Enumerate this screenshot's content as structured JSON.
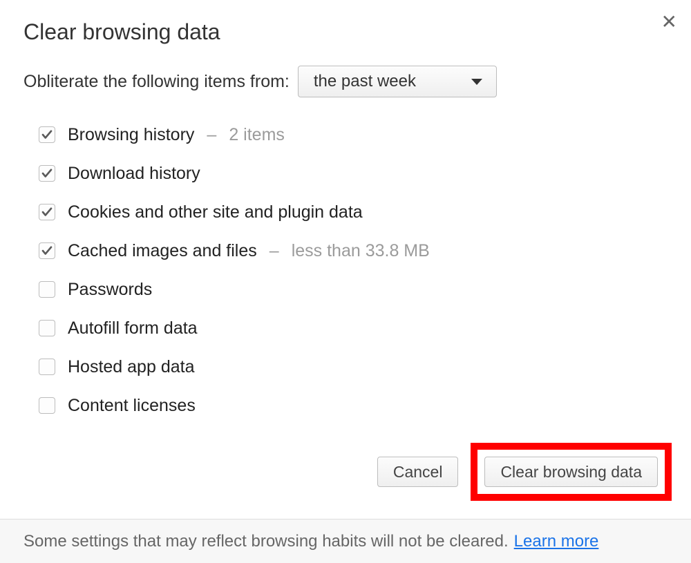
{
  "dialog": {
    "title": "Clear browsing data",
    "time_label": "Obliterate the following items from:",
    "time_selected": "the past week",
    "options": [
      {
        "label": "Browsing history",
        "checked": true,
        "hint": "2 items"
      },
      {
        "label": "Download history",
        "checked": true,
        "hint": null
      },
      {
        "label": "Cookies and other site and plugin data",
        "checked": true,
        "hint": null
      },
      {
        "label": "Cached images and files",
        "checked": true,
        "hint": "less than 33.8 MB"
      },
      {
        "label": "Passwords",
        "checked": false,
        "hint": null
      },
      {
        "label": "Autofill form data",
        "checked": false,
        "hint": null
      },
      {
        "label": "Hosted app data",
        "checked": false,
        "hint": null
      },
      {
        "label": "Content licenses",
        "checked": false,
        "hint": null
      }
    ],
    "buttons": {
      "cancel": "Cancel",
      "confirm": "Clear browsing data"
    },
    "footer_text": "Some settings that may reflect browsing habits will not be cleared.",
    "footer_link": "Learn more"
  }
}
